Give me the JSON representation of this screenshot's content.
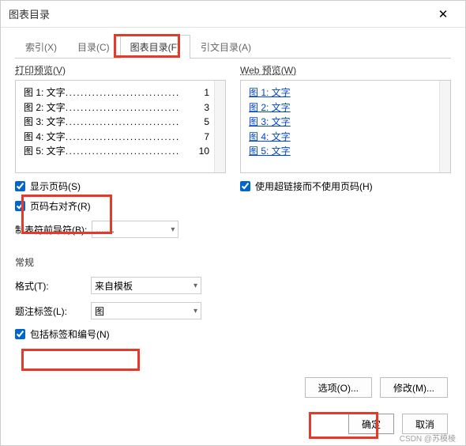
{
  "title": "图表目录",
  "tabs": [
    "索引(X)",
    "目录(C)",
    "图表目录(F)",
    "引文目录(A)"
  ],
  "printPreview": {
    "label": "打印预览(V)",
    "entries": [
      {
        "text": "图 1: 文字",
        "page": "1"
      },
      {
        "text": "图 2: 文字",
        "page": "3"
      },
      {
        "text": "图 3: 文字",
        "page": "5"
      },
      {
        "text": "图 4: 文字",
        "page": "7"
      },
      {
        "text": "图 5: 文字",
        "page": "10"
      }
    ]
  },
  "webPreview": {
    "label": "Web 预览(W)",
    "entries": [
      "图 1: 文字",
      "图 2: 文字",
      "图 3: 文字",
      "图 4: 文字",
      "图 5: 文字"
    ]
  },
  "showPageNumbers": "显示页码(S)",
  "rightAlignPageNumbers": "页码右对齐(R)",
  "useHyperlinks": "使用超链接而不使用页码(H)",
  "tabLeader": {
    "label": "制表符前导符(B):",
    "value": "......."
  },
  "general": "常规",
  "format": {
    "label": "格式(T):",
    "value": "来自模板"
  },
  "captionLabel": {
    "label": "题注标签(L):",
    "value": "图"
  },
  "includeLabelNumber": "包括标签和编号(N)",
  "buttons": {
    "options": "选项(O)...",
    "modify": "修改(M)...",
    "ok": "确定",
    "cancel": "取消"
  },
  "watermark": "CSDN @苏模棱"
}
